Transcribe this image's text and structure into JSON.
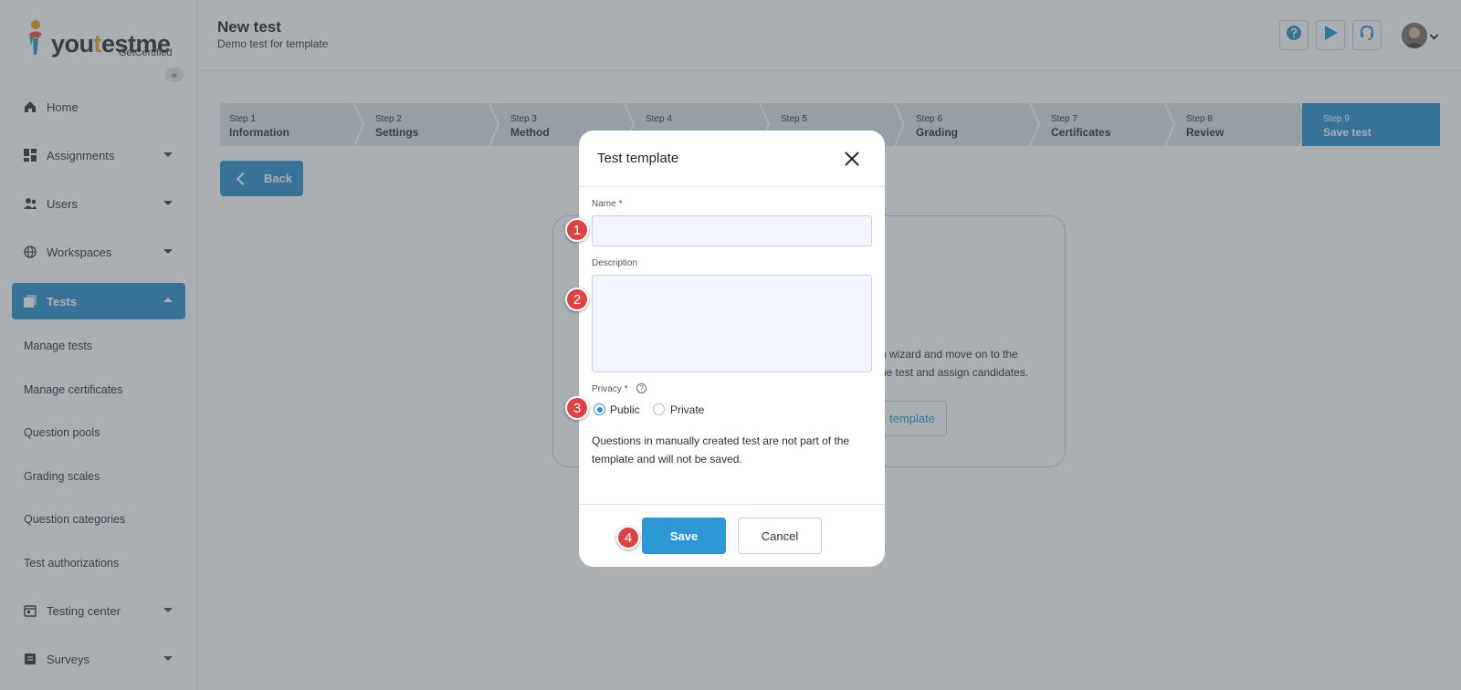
{
  "logo": {
    "word_a": "you",
    "word_b": "t",
    "word_c": "estme",
    "sub": "GetCertified"
  },
  "sidebar": {
    "collapse_glyph": "«",
    "items": [
      {
        "label": "Home",
        "icon": "home-icon"
      },
      {
        "label": "Assignments",
        "icon": "assignments-icon"
      },
      {
        "label": "Users",
        "icon": "users-icon"
      },
      {
        "label": "Workspaces",
        "icon": "globe-icon"
      },
      {
        "label": "Tests",
        "icon": "tests-icon"
      },
      {
        "label": "Testing center",
        "icon": "calendar-icon"
      },
      {
        "label": "Surveys",
        "icon": "survey-icon"
      }
    ],
    "sub_items": [
      "Manage tests",
      "Manage certificates",
      "Question pools",
      "Grading scales",
      "Question categories",
      "Test authorizations"
    ]
  },
  "header": {
    "title": "New test",
    "subtitle": "Demo test for template"
  },
  "steps": [
    {
      "num": "Step 1",
      "name": "Information"
    },
    {
      "num": "Step 2",
      "name": "Settings"
    },
    {
      "num": "Step 3",
      "name": "Method"
    },
    {
      "num": "Step 4",
      "name": ""
    },
    {
      "num": "Step 5",
      "name": ""
    },
    {
      "num": "Step 6",
      "name": "Grading"
    },
    {
      "num": "Step 7",
      "name": "Certificates"
    },
    {
      "num": "Step 8",
      "name": "Review"
    },
    {
      "num": "Step 9",
      "name": "Save test"
    }
  ],
  "back_label": "Back",
  "background_card": {
    "line1": "n wizard and move on to the",
    "line2": "he test and assign candidates.",
    "button": "template"
  },
  "modal": {
    "title": "Test template",
    "name_label": "Name",
    "required_mark": "*",
    "name_value": "",
    "description_label": "Description",
    "description_value": "",
    "privacy_label": "Privacy",
    "help_glyph": "?",
    "options": [
      "Public",
      "Private"
    ],
    "selected_option": "Public",
    "note": "Questions in manually created test are not part of the template and will not be saved.",
    "save_label": "Save",
    "cancel_label": "Cancel"
  },
  "badges": [
    "1",
    "2",
    "3",
    "4"
  ],
  "colors": {
    "accent": "#2e8fc7",
    "badge": "#d94343",
    "overlay": "rgba(70,80,92,0.46)"
  }
}
